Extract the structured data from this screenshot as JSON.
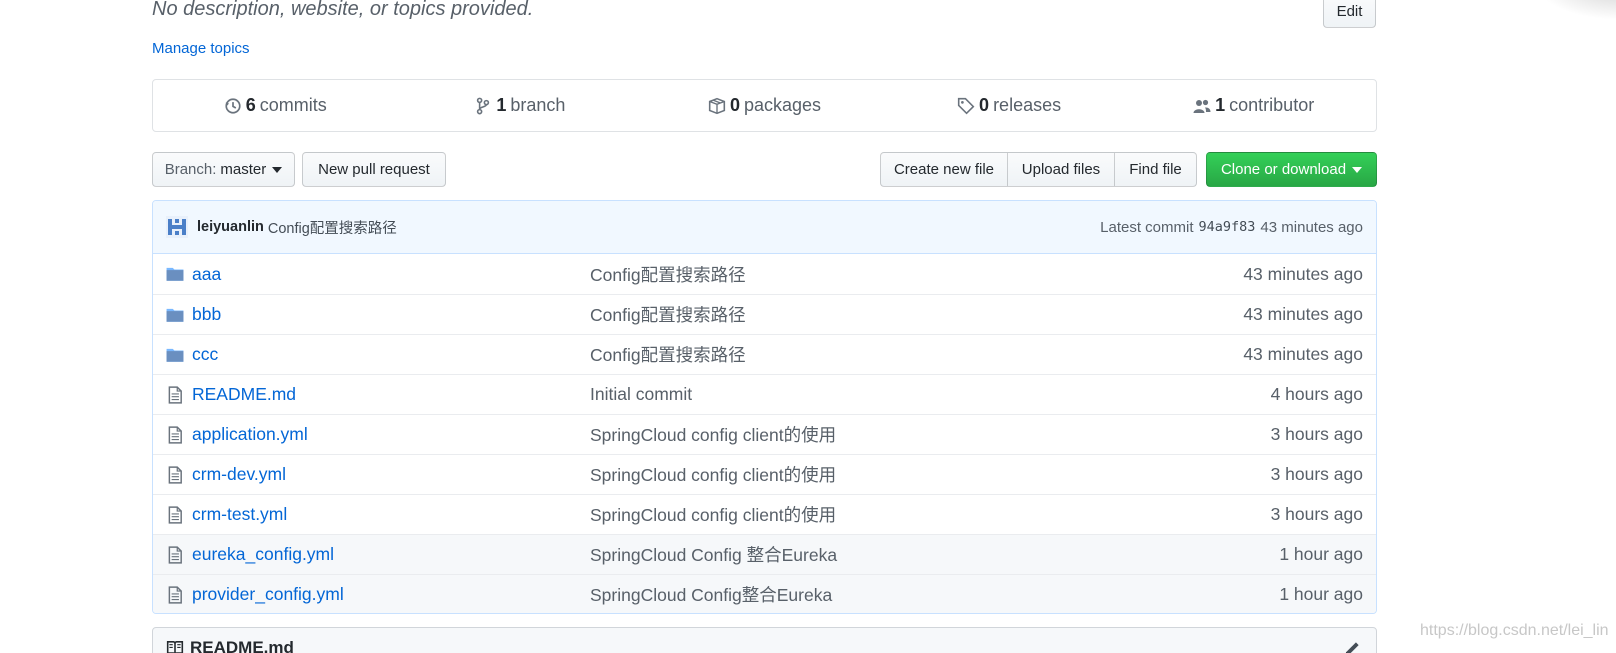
{
  "repo": {
    "description": "No description, website, or topics provided.",
    "edit_label": "Edit",
    "manage_topics_label": "Manage topics"
  },
  "numbers_summary": {
    "commits": {
      "count": "6",
      "label": "commits"
    },
    "branches": {
      "count": "1",
      "label": "branch"
    },
    "packages": {
      "count": "0",
      "label": "packages"
    },
    "releases": {
      "count": "0",
      "label": "releases"
    },
    "contributors": {
      "count": "1",
      "label": "contributor"
    }
  },
  "toolbar": {
    "branch_prefix": "Branch:",
    "branch_name": "master",
    "new_pull_request": "New pull request",
    "create_new_file": "Create new file",
    "upload_files": "Upload files",
    "find_file": "Find file",
    "clone_or_download": "Clone or download"
  },
  "latest_commit": {
    "author": "leiyuanlin",
    "message": "Config配置搜索路径",
    "prefix": "Latest commit",
    "sha": "94a9f83",
    "age": "43 minutes ago"
  },
  "files": [
    {
      "type": "folder",
      "name": "aaa",
      "message": "Config配置搜索路径",
      "age": "43 minutes ago"
    },
    {
      "type": "folder",
      "name": "bbb",
      "message": "Config配置搜索路径",
      "age": "43 minutes ago"
    },
    {
      "type": "folder",
      "name": "ccc",
      "message": "Config配置搜索路径",
      "age": "43 minutes ago"
    },
    {
      "type": "file",
      "name": "README.md",
      "message": "Initial commit",
      "age": "4 hours ago"
    },
    {
      "type": "file",
      "name": "application.yml",
      "message": "SpringCloud config client的使用",
      "age": "3 hours ago"
    },
    {
      "type": "file",
      "name": "crm-dev.yml",
      "message": "SpringCloud config client的使用",
      "age": "3 hours ago"
    },
    {
      "type": "file",
      "name": "crm-test.yml",
      "message": "SpringCloud config client的使用",
      "age": "3 hours ago"
    },
    {
      "type": "file",
      "name": "eureka_config.yml",
      "message": "SpringCloud Config 整合Eureka",
      "age": "1 hour ago"
    },
    {
      "type": "file",
      "name": "provider_config.yml",
      "message": "SpringCloud Config整合Eureka",
      "age": "1 hour ago"
    }
  ],
  "readme": {
    "title": "README.md"
  },
  "watermark": "https://blog.csdn.net/lei_lin",
  "colors": {
    "link": "#0366d6",
    "clone_green": "#28a745",
    "commit_bg": "#f1f8ff"
  }
}
